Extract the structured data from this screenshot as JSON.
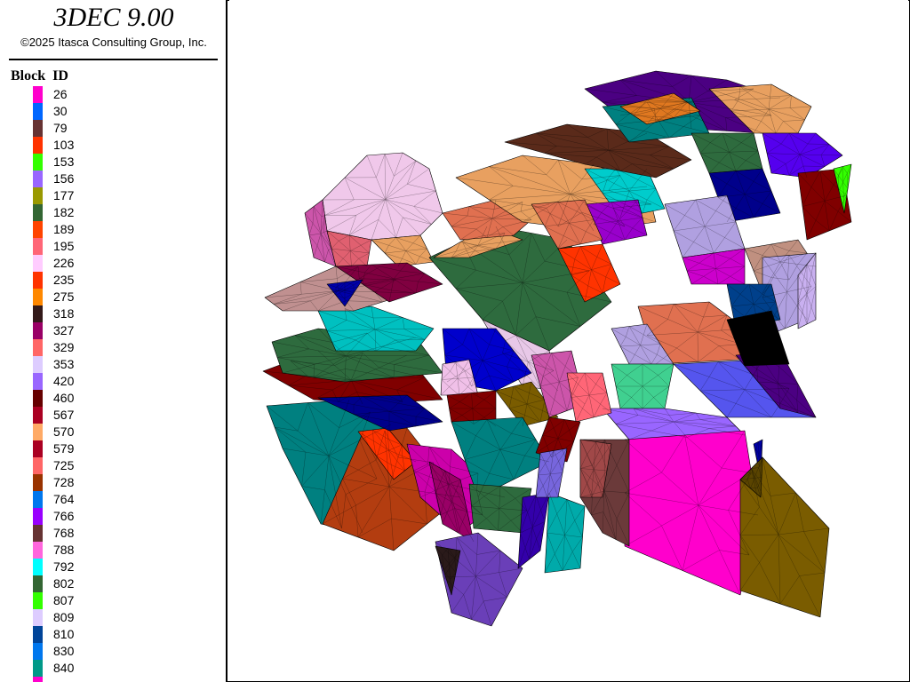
{
  "header": {
    "app_title": "3DEC 9.00",
    "copyright": "©2025 Itasca Consulting Group, Inc."
  },
  "legend": {
    "heading": "Block  ID",
    "items": [
      {
        "label": "26",
        "color": "#ff00cc"
      },
      {
        "label": "30",
        "color": "#0066ff"
      },
      {
        "label": "79",
        "color": "#663333"
      },
      {
        "label": "103",
        "color": "#ff3300"
      },
      {
        "label": "153",
        "color": "#33ff00"
      },
      {
        "label": "156",
        "color": "#9966ff"
      },
      {
        "label": "177",
        "color": "#999900"
      },
      {
        "label": "182",
        "color": "#336633"
      },
      {
        "label": "189",
        "color": "#ff4400"
      },
      {
        "label": "195",
        "color": "#ff6677"
      },
      {
        "label": "226",
        "color": "#ffccff"
      },
      {
        "label": "235",
        "color": "#ff3300"
      },
      {
        "label": "275",
        "color": "#ff8800"
      },
      {
        "label": "318",
        "color": "#331a1a"
      },
      {
        "label": "327",
        "color": "#990066"
      },
      {
        "label": "329",
        "color": "#ff6666"
      },
      {
        "label": "353",
        "color": "#ddccff"
      },
      {
        "label": "420",
        "color": "#9966ff"
      },
      {
        "label": "460",
        "color": "#660000"
      },
      {
        "label": "567",
        "color": "#aa0022"
      },
      {
        "label": "570",
        "color": "#ffaa66"
      },
      {
        "label": "579",
        "color": "#aa0022"
      },
      {
        "label": "725",
        "color": "#ff6666"
      },
      {
        "label": "728",
        "color": "#993300"
      },
      {
        "label": "764",
        "color": "#0077ee"
      },
      {
        "label": "766",
        "color": "#9900ff"
      },
      {
        "label": "768",
        "color": "#663333"
      },
      {
        "label": "788",
        "color": "#ff66dd"
      },
      {
        "label": "792",
        "color": "#00ffff"
      },
      {
        "label": "802",
        "color": "#336633"
      },
      {
        "label": "807",
        "color": "#33ff00"
      },
      {
        "label": "809",
        "color": "#ddccff"
      },
      {
        "label": "810",
        "color": "#004499"
      },
      {
        "label": "830",
        "color": "#0077ee"
      },
      {
        "label": "840",
        "color": "#009988"
      },
      {
        "label": "",
        "color": "#ff00cc"
      }
    ]
  },
  "model": {
    "description_colors": [
      "#ff00cc",
      "#008080",
      "#2e6b3e",
      "#e8a060",
      "#9900cc",
      "#00cccc",
      "#b03010",
      "#5555ee",
      "#7a5c00",
      "#cc55aa",
      "#f0c0e8",
      "#800000",
      "#0000aa",
      "#e07050"
    ]
  }
}
